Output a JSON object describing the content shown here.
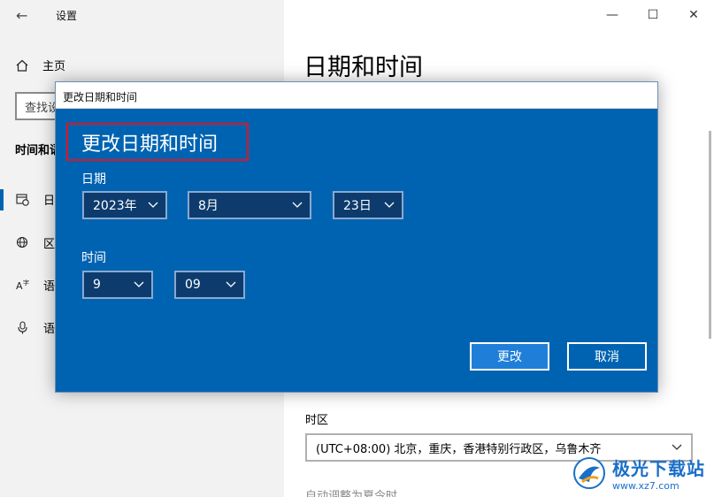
{
  "app": {
    "title": "设置",
    "back_glyph": "←"
  },
  "window_controls": {
    "minimize": "—",
    "maximize": "☐",
    "close": "✕"
  },
  "left_pane": {
    "home_label": "主页",
    "search_placeholder": "查找设",
    "section_header": "时间和语",
    "nav_items": [
      {
        "label": "日",
        "icon": "calendar-clock-icon"
      },
      {
        "label": "区",
        "icon": "globe-icon"
      },
      {
        "label": "语",
        "icon": "language-icon"
      },
      {
        "label": "语",
        "icon": "microphone-icon"
      }
    ]
  },
  "right_pane": {
    "page_title": "日期和时间",
    "timezone_label": "时区",
    "timezone_value": "(UTC+08:00) 北京，重庆，香港特别行政区，乌鲁木齐",
    "auto_dst_label": "自动调整为夏令时"
  },
  "dialog": {
    "window_title": "更改日期和时间",
    "heading": "更改日期和时间",
    "date_label": "日期",
    "year_value": "2023年",
    "month_value": "8月",
    "day_value": "23日",
    "time_label": "时间",
    "hour_value": "9",
    "minute_value": "09",
    "change_button": "更改",
    "cancel_button": "取消"
  },
  "watermark": {
    "brand": "极光下载站",
    "url": "www.xz7.com"
  },
  "colors": {
    "dialog_bg": "#0063b1",
    "dropdown_bg": "#0d3b6e",
    "primary_button": "#1f7fd8",
    "highlight_border": "#e0141e",
    "accent": "#0063b1"
  }
}
